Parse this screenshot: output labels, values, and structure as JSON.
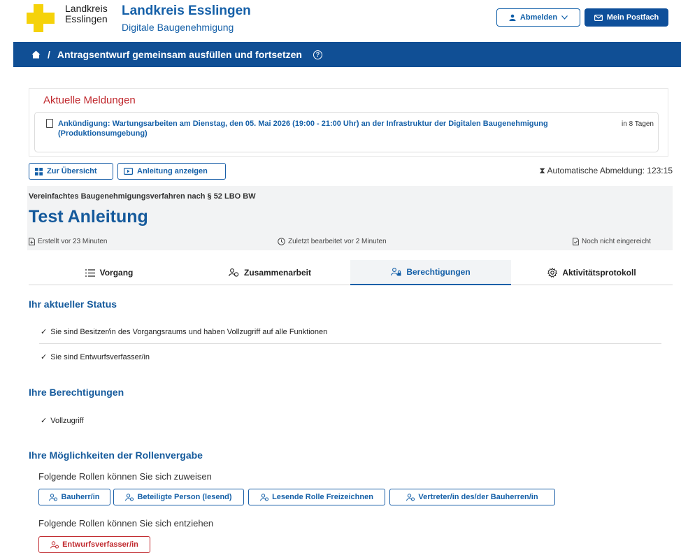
{
  "header": {
    "logo_line1": "Landkreis",
    "logo_line2": "Esslingen",
    "title": "Landkreis Esslingen",
    "subtitle": "Digitale Baugenehmigung",
    "logout_label": "Abmelden",
    "mailbox_label": "Mein Postfach"
  },
  "breadcrumb": {
    "title": "Antragsentwurf gemeinsam ausfüllen und fortsetzen"
  },
  "news": {
    "heading": "Aktuelle Meldungen",
    "items": [
      {
        "text": "Ankündigung: Wartungsarbeiten am Dienstag, den 05. Mai 2026 (19:00 - 21:00 Uhr) an der Infrastruktur der Digitalen Baugenehmigung (Produktionsumgebung)",
        "when": "in 8 Tagen"
      }
    ]
  },
  "toolbar": {
    "overview_label": "Zur Übersicht",
    "guide_label": "Anleitung anzeigen",
    "auto_logout": "Automatische Abmeldung: 123:15"
  },
  "process": {
    "type": "Vereinfachtes Baugenehmigungsverfahren nach § 52 LBO BW",
    "title": "Test Anleitung",
    "created": "Erstellt vor 23 Minuten",
    "edited": "Zuletzt bearbeitet vor 2 Minuten",
    "submitted": "Noch nicht eingereicht"
  },
  "tabs": [
    {
      "label": "Vorgang",
      "icon": "list-icon"
    },
    {
      "label": "Zusammenarbeit",
      "icon": "users-icon"
    },
    {
      "label": "Berechtigungen",
      "icon": "user-lock-icon",
      "active": true
    },
    {
      "label": "Aktivitätsprotokoll",
      "icon": "gear-icon"
    }
  ],
  "status": {
    "heading": "Ihr aktueller Status",
    "items": [
      "Sie sind Besitzer/in des Vorgangsraums und haben Vollzugriff auf alle Funktionen",
      "Sie sind Entwurfsverfasser/in"
    ]
  },
  "permissions": {
    "heading": "Ihre Berechtigungen",
    "items": [
      "Vollzugriff"
    ]
  },
  "roles": {
    "heading": "Ihre Möglichkeiten der Rollenvergabe",
    "assign_label": "Folgende Rollen können Sie sich zuweisen",
    "assign": [
      "Bauherr/in",
      "Beteiligte Person (lesend)",
      "Lesende Rolle Freizeichnen",
      "Vertreter/in des/der Bauherren/in"
    ],
    "remove_label": "Folgende Rollen können Sie sich entziehen",
    "remove": [
      "Entwurfsverfasser/in"
    ]
  },
  "colors": {
    "primary": "#104f95",
    "accent": "#1560a8",
    "alert": "#c0282d",
    "logo_yellow": "#f5d20a"
  }
}
